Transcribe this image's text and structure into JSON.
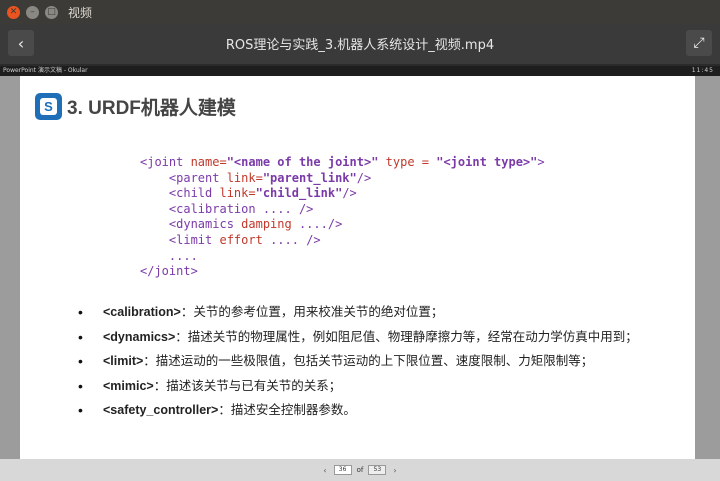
{
  "window": {
    "title": "视频"
  },
  "video": {
    "title": "ROS理论与实践_3.机器人系统设计_视频.mp4"
  },
  "inner_panel": {
    "left_text": "PowerPoint 演示文稿 - Okular",
    "right_text": "11:45"
  },
  "slide": {
    "title": "3. URDF机器人建模",
    "code": {
      "line1_open": "<joint ",
      "line1_name_attr": "name=",
      "line1_name_val": "\"<name of the joint>\"",
      "line1_type_attr": " type = ",
      "line1_type_val": "\"<joint type>\"",
      "line1_close": ">",
      "line2_tag": "    <parent ",
      "line2_attr": "link=",
      "line2_val": "\"parent_link\"",
      "line2_close": "/>",
      "line3_tag": "    <child ",
      "line3_attr": "link=",
      "line3_val": "\"child_link\"",
      "line3_close": "/>",
      "line4": "    <calibration .... />",
      "line5_tag": "    <dynamics ",
      "line5_attr": "damping",
      "line5_close": " ..../>",
      "line6_tag": "    <limit ",
      "line6_attr": "effort",
      "line6_close": " .... />",
      "line7": "    ....",
      "line8": "</joint>"
    },
    "bullets": [
      {
        "term": "<calibration>",
        "desc": "：关节的参考位置，用来校准关节的绝对位置；"
      },
      {
        "term": "<dynamics>",
        "desc": "：描述关节的物理属性，例如阻尼值、物理静摩擦力等，经常在动力学仿真中用到；"
      },
      {
        "term": "<limit>",
        "desc": "：描述运动的一些极限值，包括关节运动的上下限位置、速度限制、力矩限制等；"
      },
      {
        "term": "<mimic>",
        "desc": "：描述该关节与已有关节的关系；"
      },
      {
        "term": "<safety_controller>",
        "desc": "：描述安全控制器参数。"
      }
    ]
  },
  "pager": {
    "current": "36",
    "of_label": "of",
    "total": "53"
  }
}
